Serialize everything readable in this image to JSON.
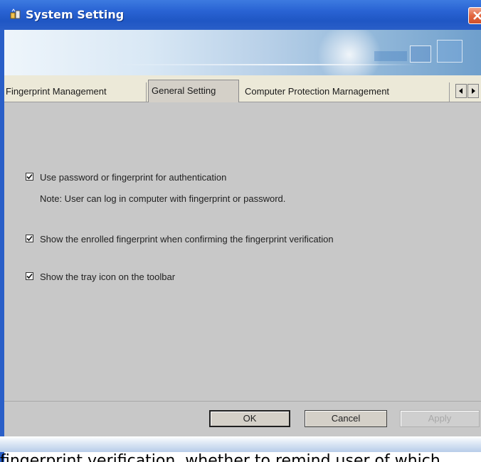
{
  "window": {
    "title": "System Setting",
    "title_icon": "app-fingerprint-icon",
    "close_icon": "close-icon",
    "accent_color": "#2a5fc8"
  },
  "tabs": [
    {
      "label": "Fingerprint Management",
      "selected": false
    },
    {
      "label": "General Setting",
      "selected": true
    },
    {
      "label": "Computer Protection Marnagement",
      "selected": false
    }
  ],
  "tab_scroll": {
    "left_icon": "arrow-left-icon",
    "right_icon": "arrow-right-icon"
  },
  "options": [
    {
      "label": "Use password or fingerprint for authentication",
      "checked": true
    },
    {
      "label": "Show the enrolled fingerprint when confirming the fingerprint verification",
      "checked": true
    },
    {
      "label": "Show the tray icon on the toolbar",
      "checked": true
    }
  ],
  "note": "Note: User can log in computer with fingerprint or password.",
  "buttons": {
    "ok": "OK",
    "cancel": "Cancel",
    "apply": "Apply"
  },
  "caption": "fingerprint verification, whether to remind user of which"
}
